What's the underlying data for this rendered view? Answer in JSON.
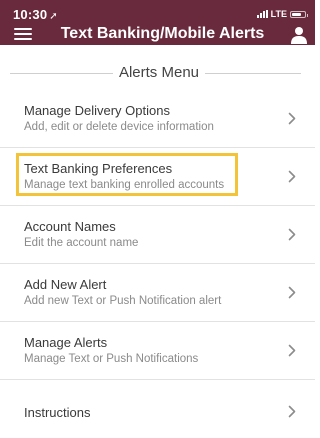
{
  "status_bar": {
    "time": "10:30",
    "location_glyph": "➚",
    "network": "LTE"
  },
  "header": {
    "title": "Text Banking/Mobile Alerts",
    "background_color": "#6a2a3d"
  },
  "menu": {
    "title": "Alerts Menu",
    "items": [
      {
        "label": "Manage Delivery Options",
        "sublabel": "Add, edit or delete device information"
      },
      {
        "label": "Text Banking Preferences",
        "sublabel": "Manage text banking enrolled accounts"
      },
      {
        "label": "Account Names",
        "sublabel": "Edit the account name"
      },
      {
        "label": "Add New Alert",
        "sublabel": "Add new Text or Push Notification alert"
      },
      {
        "label": "Manage Alerts",
        "sublabel": "Manage Text or Push Notifications"
      },
      {
        "label": "Instructions"
      }
    ]
  },
  "highlight_color": "#f3c43a"
}
